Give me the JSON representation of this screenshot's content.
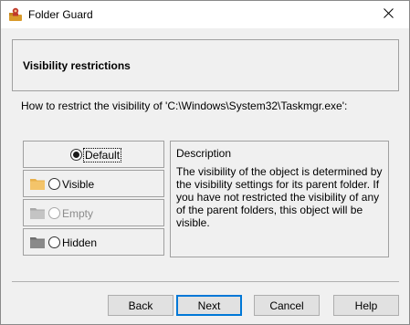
{
  "window": {
    "title": "Folder Guard",
    "icon": "folder-guard-app-icon",
    "close_icon": "close-icon"
  },
  "header": {
    "title": "Visibility restrictions"
  },
  "question": "How to restrict the visibility of 'C:\\Windows\\System32\\Taskmgr.exe':",
  "options": [
    {
      "label": "Default",
      "selected": true,
      "enabled": true,
      "icon": "none"
    },
    {
      "label": "Visible",
      "selected": false,
      "enabled": true,
      "icon": "yellow-folder-icon",
      "icon_color": "#e8b04b"
    },
    {
      "label": "Empty",
      "selected": false,
      "enabled": false,
      "icon": "grey-folder-icon",
      "icon_color": "#b8b8b8"
    },
    {
      "label": "Hidden",
      "selected": false,
      "enabled": true,
      "icon": "dark-folder-icon",
      "icon_color": "#7a7a7a"
    }
  ],
  "description": {
    "title": "Description",
    "text": "The visibility of the object is determined by the visibility settings for its parent folder. If you have not restricted the visibility of any of the parent folders, this object will be visible."
  },
  "buttons": {
    "back": "Back",
    "next": "Next",
    "cancel": "Cancel",
    "help": "Help"
  },
  "colors": {
    "accent": "#0078d7",
    "window_bg": "#f0f0f0",
    "titlebar_bg": "#ffffff"
  }
}
